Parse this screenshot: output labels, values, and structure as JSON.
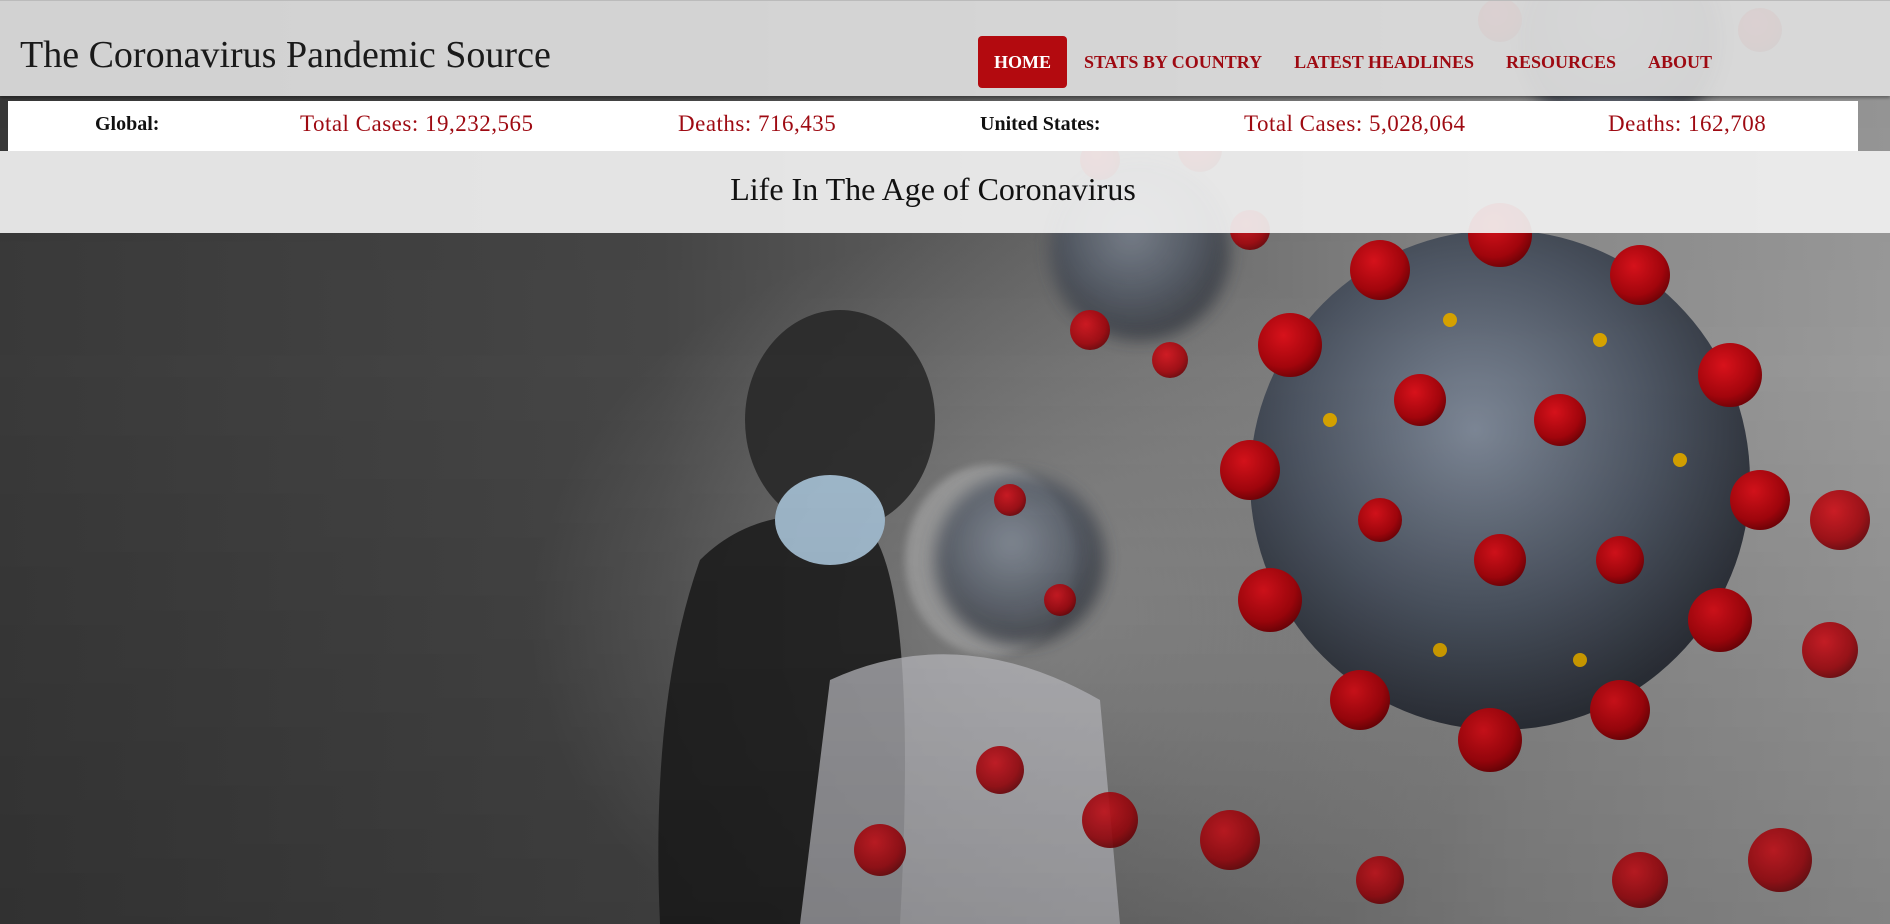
{
  "header": {
    "site_title": "The Coronavirus Pandemic Source",
    "nav": [
      {
        "label": "HOME",
        "active": true
      },
      {
        "label": "STATS BY COUNTRY",
        "active": false
      },
      {
        "label": "LATEST HEADLINES",
        "active": false
      },
      {
        "label": "RESOURCES",
        "active": false
      },
      {
        "label": "ABOUT",
        "active": false
      }
    ]
  },
  "stats": {
    "global_label": "Global:",
    "global_cases": "Total Cases: 19,232,565",
    "global_deaths": "Deaths: 716,435",
    "us_label": "United States:",
    "us_cases": "Total Cases: 5,028,064",
    "us_deaths": "Deaths: 162,708"
  },
  "subtitle": "Life In The Age of Coronavirus",
  "colors": {
    "accent": "#b30a0f",
    "accent_text": "#9e0a12",
    "header_bg": "#dcdcdc"
  }
}
